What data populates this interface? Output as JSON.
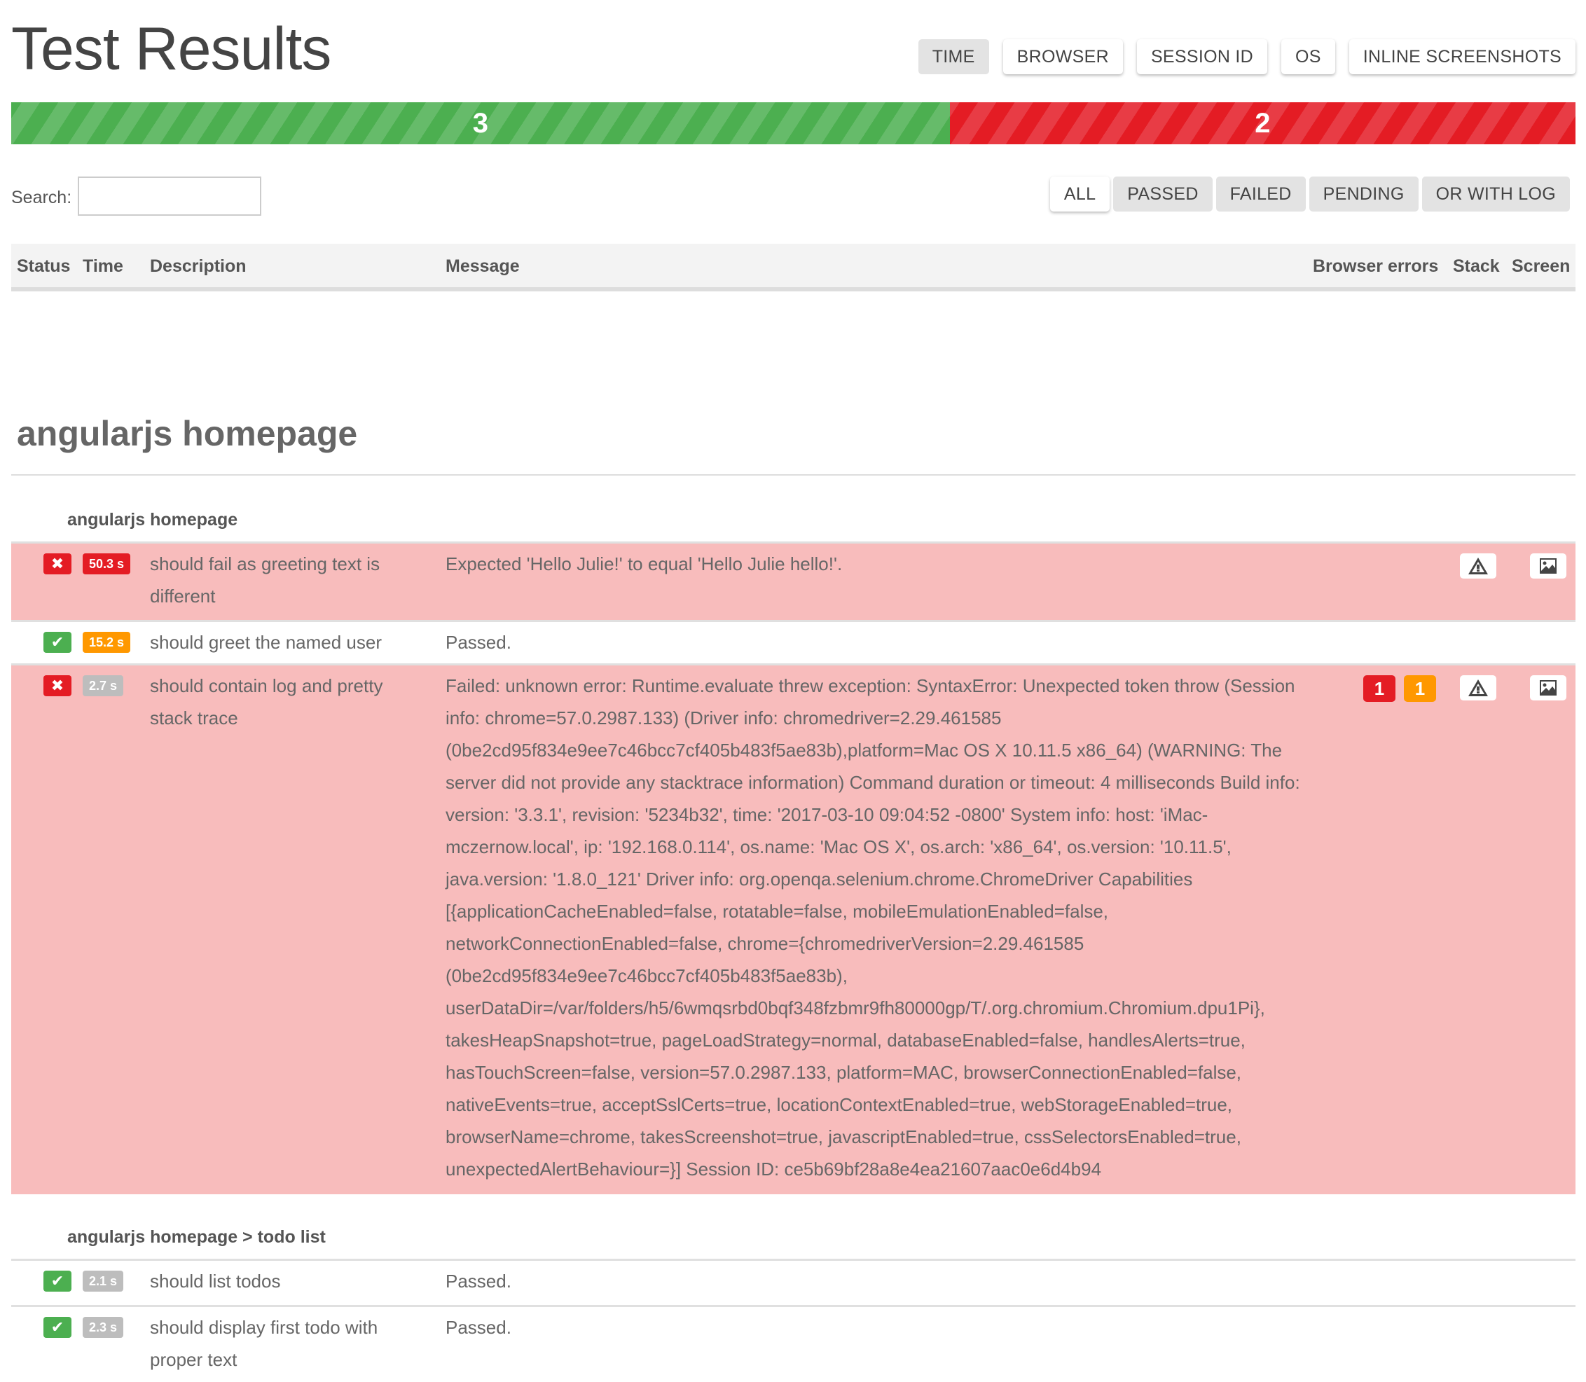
{
  "header": {
    "title": "Test Results",
    "view_buttons": [
      {
        "label": "TIME",
        "active": true
      },
      {
        "label": "BROWSER",
        "active": false
      },
      {
        "label": "SESSION ID",
        "active": false
      },
      {
        "label": "OS",
        "active": false
      },
      {
        "label": "INLINE SCREENSHOTS",
        "active": false
      }
    ]
  },
  "progress": {
    "passed": "3",
    "failed": "2",
    "passed_fraction": 0.6,
    "colors": {
      "passed": "#4caf50",
      "failed": "#e41c24"
    }
  },
  "search": {
    "label": "Search:",
    "value": "",
    "placeholder": ""
  },
  "filters": [
    {
      "label": "ALL",
      "active": true
    },
    {
      "label": "PASSED",
      "active": false
    },
    {
      "label": "FAILED",
      "active": false
    },
    {
      "label": "PENDING",
      "active": false
    },
    {
      "label": "OR WITH LOG",
      "active": false
    }
  ],
  "table_headers": {
    "status": "Status",
    "time": "Time",
    "description": "Description",
    "message": "Message",
    "browser_errors": "Browser errors",
    "stack": "Stack",
    "screen": "Screen"
  },
  "suite": {
    "title": "angularjs homepage",
    "groups": [
      {
        "title": "angularjs homepage",
        "rows": [
          {
            "status": "failed",
            "status_icon": "cross-icon",
            "time": "50.3 s",
            "time_color": "red",
            "description": "should fail as greeting text is different",
            "message": "Expected 'Hello Julie!' to equal 'Hello Julie hello!'.",
            "browser_errors": [],
            "has_stack": true,
            "has_screenshot": true
          },
          {
            "status": "passed",
            "status_icon": "check-icon",
            "time": "15.2 s",
            "time_color": "orange",
            "description": "should greet the named user",
            "message": "Passed.",
            "browser_errors": [],
            "has_stack": false,
            "has_screenshot": false
          },
          {
            "status": "failed",
            "status_icon": "cross-icon",
            "time": "2.7 s",
            "time_color": "grey",
            "description": "should contain log and pretty stack trace",
            "message": "Failed: unknown error: Runtime.evaluate threw exception: SyntaxError: Unexpected token throw (Session info: chrome=57.0.2987.133) (Driver info: chromedriver=2.29.461585 (0be2cd95f834e9ee7c46bcc7cf405b483f5ae83b),platform=Mac OS X 10.11.5 x86_64) (WARNING: The server did not provide any stacktrace information) Command duration or timeout: 4 milliseconds Build info: version: '3.3.1', revision: '5234b32', time: '2017-03-10 09:04:52 -0800' System info: host: 'iMac-mczernow.local', ip: '192.168.0.114', os.name: 'Mac OS X', os.arch: 'x86_64', os.version: '10.11.5', java.version: '1.8.0_121' Driver info: org.openqa.selenium.chrome.ChromeDriver Capabilities [{applicationCacheEnabled=false, rotatable=false, mobileEmulationEnabled=false, networkConnectionEnabled=false, chrome={chromedriverVersion=2.29.461585 (0be2cd95f834e9ee7c46bcc7cf405b483f5ae83b), userDataDir=/var/folders/h5/6wmqsrbd0bqf348fzbmr9fh80000gp/T/.org.chromium.Chromium.dpu1Pi}, takesHeapSnapshot=true, pageLoadStrategy=normal, databaseEnabled=false, handlesAlerts=true, hasTouchScreen=false, version=57.0.2987.133, platform=MAC, browserConnectionEnabled=false, nativeEvents=true, acceptSslCerts=true, locationContextEnabled=true, webStorageEnabled=true, browserName=chrome, takesScreenshot=true, javascriptEnabled=true, cssSelectorsEnabled=true, unexpectedAlertBehaviour=}] Session ID: ce5b69bf28a8e4ea21607aac0e6d4b94",
            "browser_errors": [
              {
                "count": "1",
                "level": "severe",
                "color": "#e41c24"
              },
              {
                "count": "1",
                "level": "warning",
                "color": "#ff9800"
              }
            ],
            "has_stack": true,
            "has_screenshot": true
          }
        ]
      },
      {
        "title": "angularjs homepage > todo list",
        "rows": [
          {
            "status": "passed",
            "status_icon": "check-icon",
            "time": "2.1 s",
            "time_color": "grey",
            "description": "should list todos",
            "message": "Passed.",
            "browser_errors": [],
            "has_stack": false,
            "has_screenshot": false
          },
          {
            "status": "passed",
            "status_icon": "check-icon",
            "time": "2.3 s",
            "time_color": "grey",
            "description": "should display first todo with proper text",
            "message": "Passed.",
            "browser_errors": [],
            "has_stack": false,
            "has_screenshot": false
          }
        ]
      }
    ]
  },
  "icons": {
    "fail": "✖",
    "pass": "✔",
    "stack": "warning-triangle-icon",
    "screen": "image-icon"
  }
}
